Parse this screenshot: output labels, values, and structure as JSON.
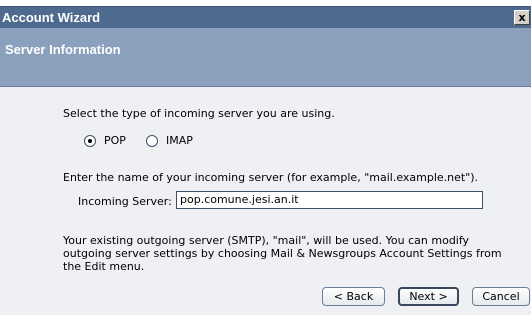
{
  "window": {
    "title": "Account Wizard",
    "close_label": "x"
  },
  "header": {
    "title": "Server Information"
  },
  "server_type": {
    "prompt": "Select the type of incoming server you are using.",
    "options": [
      "POP",
      "IMAP"
    ],
    "selected": "POP"
  },
  "incoming": {
    "prompt": "Enter the name of your incoming server (for example, \"mail.example.net\").",
    "label": "Incoming Server:",
    "value": "pop.comune.jesi.an.it"
  },
  "outgoing_note": [
    "Your existing outgoing server (SMTP), \"mail\", will be used. You can modify",
    "outgoing server settings by choosing Mail & Newsgroups Account Settings from",
    "the Edit menu."
  ],
  "buttons": {
    "back": "< Back",
    "next": "Next >",
    "cancel": "Cancel"
  }
}
